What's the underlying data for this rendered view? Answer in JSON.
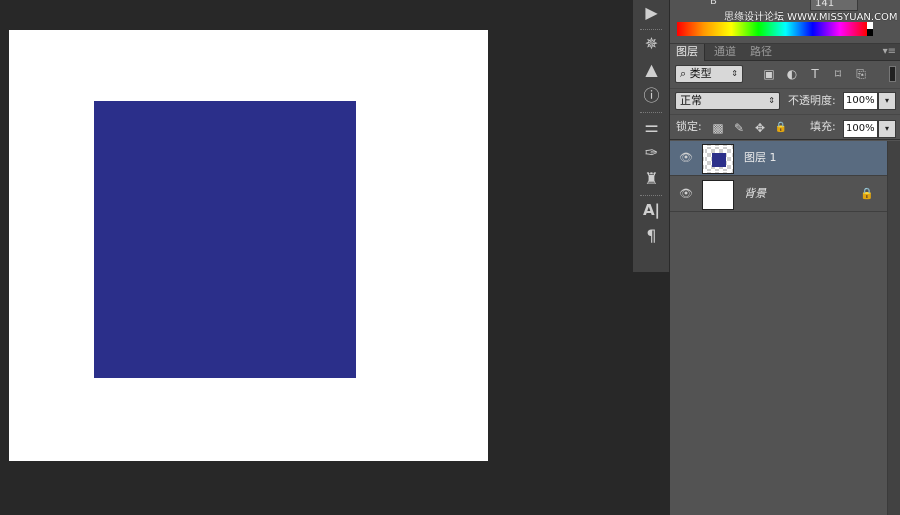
{
  "colors": {
    "square_fill": "#2b2f8a",
    "layer1_thumb_fill": "#2b2f8a"
  },
  "color_panel": {
    "channel_label": "B",
    "channel_value": "141",
    "watermark": "思缘设计论坛 WWW.MISSYUAN.COM"
  },
  "strip_icons": [
    {
      "name": "play-icon",
      "glyph": "▶"
    },
    {
      "name": "wheel-icon",
      "glyph": "✵"
    },
    {
      "name": "histogram-icon",
      "glyph": "▲"
    },
    {
      "name": "info-icon",
      "glyph": "ⓘ"
    },
    {
      "name": "adjust-sliders-icon",
      "glyph": "⚌"
    },
    {
      "name": "brush-presets-icon",
      "glyph": "✑"
    },
    {
      "name": "clone-stamp-icon",
      "glyph": "♜"
    },
    {
      "name": "character-icon",
      "glyph": "A|"
    },
    {
      "name": "paragraph-icon",
      "glyph": "¶"
    }
  ],
  "tabs": [
    {
      "label": "图层",
      "active": true
    },
    {
      "label": "通道",
      "active": false
    },
    {
      "label": "路径",
      "active": false
    }
  ],
  "panel_menu_glyph": "▾≡",
  "filter": {
    "search_glyph": "⌕",
    "value": "类型",
    "arrow": "⇕",
    "icons": [
      {
        "name": "image-filter-icon",
        "glyph": "▣"
      },
      {
        "name": "adjustment-filter-icon",
        "glyph": "◐"
      },
      {
        "name": "type-filter-icon",
        "glyph": "T"
      },
      {
        "name": "shape-filter-icon",
        "glyph": "⌑"
      },
      {
        "name": "smart-object-filter-icon",
        "glyph": "⎘"
      }
    ]
  },
  "blend": {
    "mode": "正常",
    "arrow": "⇕",
    "opacity_label": "不透明度:",
    "opacity_value": "100%",
    "drop_glyph": "▾"
  },
  "lock": {
    "label": "锁定:",
    "icons": [
      {
        "name": "lock-transparent-icon",
        "glyph": "▩"
      },
      {
        "name": "lock-pixels-icon",
        "glyph": "✎"
      },
      {
        "name": "lock-position-icon",
        "glyph": "✥"
      },
      {
        "name": "lock-all-icon",
        "glyph": "🔒"
      }
    ],
    "fill_label": "填充:",
    "fill_value": "100%",
    "drop_glyph": "▾"
  },
  "layers": [
    {
      "name": "图层 1",
      "selected": true,
      "eye": "👁"
    },
    {
      "name": "背景",
      "selected": false,
      "eye": "👁",
      "lock_glyph": "🔒"
    }
  ]
}
